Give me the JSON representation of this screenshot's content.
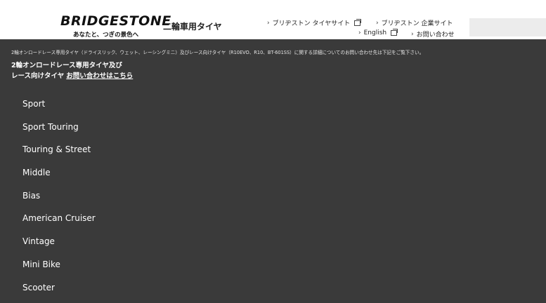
{
  "header": {
    "logo": "BRIDGESTONE",
    "tagline": "あなたと、つぎの景色へ",
    "site_label": "二輪車用タイヤ",
    "links": {
      "tire_site": "ブリヂストン タイヤサイト",
      "corporate": "ブリヂストン 企業サイト",
      "english": "English",
      "contact": "お問い合わせ"
    }
  },
  "notice": "2輪オンロードレース専用タイヤ（ドライスリック、ウェット、レーシングミニ）及びレース向けタイヤ（R10EVO、R10、BT-601SS）に関する詳細についてのお問い合わせ先は下記をご覧下さい。",
  "race": {
    "line1": "2輪オンロードレース専用タイヤ及び",
    "line2": "レース向けタイヤ",
    "link": "お問い合わせはこちら"
  },
  "menu": [
    "Sport",
    "Sport Touring",
    "Touring & Street",
    "Middle",
    "Bias",
    "American Cruiser",
    "Vintage",
    "Mini Bike",
    "Scooter"
  ]
}
